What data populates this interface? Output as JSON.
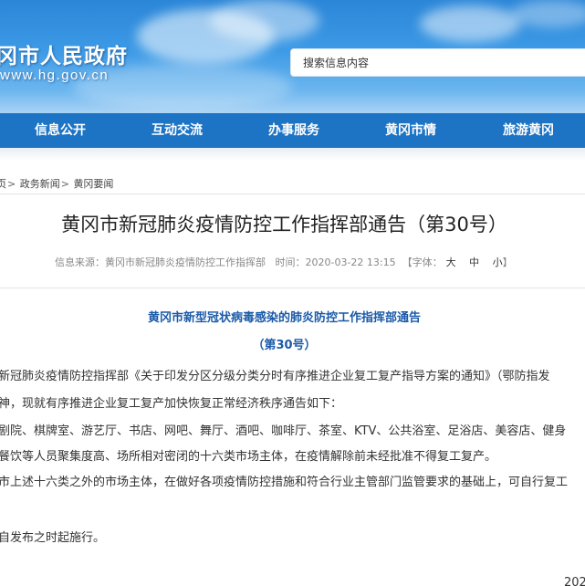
{
  "header": {
    "site_title": "冈市人民政府",
    "site_url": "www.hg.gov.cn",
    "search_placeholder": "搜索信息内容"
  },
  "nav": {
    "items": [
      "信息公开",
      "互动交流",
      "办事服务",
      "黄冈市情",
      "旅游黄冈"
    ]
  },
  "breadcrumb": {
    "home": "页",
    "items": [
      "政务新闻",
      "黄冈要闻"
    ],
    "separator": ">"
  },
  "article": {
    "title": "黄冈市新冠肺炎疫情防控工作指挥部通告（第30号）",
    "meta": {
      "source_label": "信息来源：",
      "source": "黄冈市新冠肺炎疫情防控工作指挥部",
      "time_label": "时间：",
      "time": "2020-03-22 13:15",
      "font_label": "【字体：",
      "size_large": "大",
      "size_medium": "中",
      "size_small": "小",
      "font_end": "】"
    },
    "notice_title": "黄冈市新型冠状病毒感染的肺炎防控工作指挥部通告",
    "notice_number": "（第30号）",
    "paragraphs": [
      "新冠肺炎疫情防控指挥部《关于印发分区分级分类分时有序推进企业复工复产指导方案的通知》（鄂防指发",
      "神，现就有序推进企业复工复产加快恢复正常经济秩序通告如下：",
      "剧院、棋牌室、游艺厅、书店、网吧、舞厅、酒吧、咖啡厅、茶室、KTV、公共浴室、足浴店、美容店、健身",
      "餐饮等人员聚集度高、场所相对密闭的十六类市场主体，在疫情解除前未经批准不得复工复产。",
      "市上述十六类之外的市场主体，在做好各项疫情防控措施和符合行业主管部门监管要求的基础上，可自行复工",
      "自发布之时起施行。"
    ],
    "date_partial": "202"
  },
  "colors": {
    "nav_bg": "#1d74c4",
    "notice_blue": "#1a5aa8",
    "banner_blue": "#3d9ae6"
  }
}
